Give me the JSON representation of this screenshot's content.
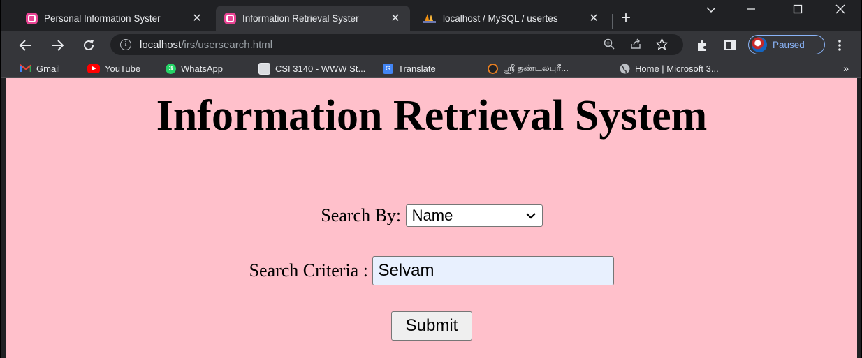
{
  "browser": {
    "tabs": [
      {
        "title": "Personal Information Syster",
        "favicon": "webstorm-icon",
        "active": false
      },
      {
        "title": "Information Retrieval Syster",
        "favicon": "webstorm-icon",
        "active": true
      },
      {
        "title": "localhost / MySQL / usertes",
        "favicon": "phpmyadmin-icon",
        "active": false
      }
    ],
    "close_glyph": "✕",
    "newtab_glyph": "+",
    "url_host": "localhost",
    "url_path": "/irs/usersearch.html",
    "profile_label": "Paused",
    "bookmarks": [
      {
        "label": "Gmail",
        "icon": "gmail-icon"
      },
      {
        "label": "YouTube",
        "icon": "youtube-icon"
      },
      {
        "label": "WhatsApp",
        "icon": "whatsapp-icon",
        "badge": "3"
      },
      {
        "label": "CSI 3140 - WWW St...",
        "icon": "building-icon"
      },
      {
        "label": "Translate",
        "icon": "translate-icon"
      },
      {
        "label": "ஸ்ரீ தண்டலபுரீ...",
        "icon": "site-icon"
      },
      {
        "label": "Home | Microsoft 3...",
        "icon": "globe-icon"
      }
    ],
    "bookmarks_more": "»"
  },
  "page": {
    "heading": "Information Retrieval System",
    "search_by_label": "Search By:",
    "search_by_value": "Name",
    "criteria_label": "Search Criteria :",
    "criteria_value": "Selvam",
    "submit_label": "Submit",
    "background": "#ffc0cb"
  }
}
